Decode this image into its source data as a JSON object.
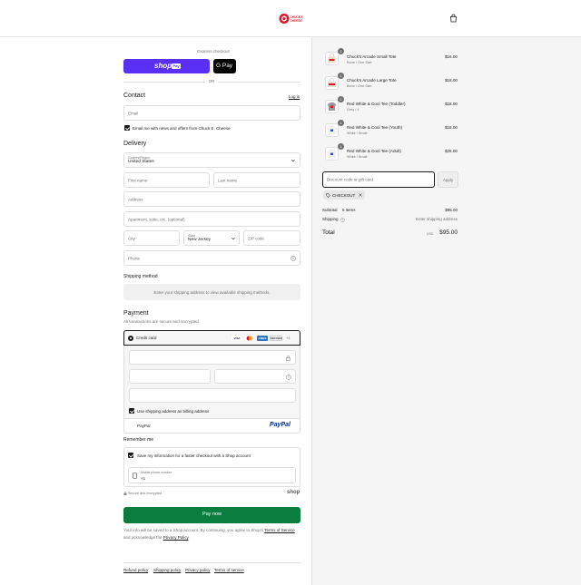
{
  "header": {
    "logo_text": "CHUCK E. CHEESE",
    "cart_icon": "shopping-bag-icon"
  },
  "express": {
    "title": "Express checkout",
    "shop_pay_label": "shop",
    "shop_pay_badge": "Pay",
    "gpay_label": "G Pay",
    "or_label": "OR"
  },
  "contact": {
    "heading": "Contact",
    "login_label": "Log in",
    "email_placeholder": "Email",
    "newsletter_label": "Email me with news and offers from Chuck E. Cheese"
  },
  "delivery": {
    "heading": "Delivery",
    "country_label": "Country/Region",
    "country_value": "United States",
    "first_name_placeholder": "First name",
    "last_name_placeholder": "Last name",
    "address_placeholder": "Address",
    "apartment_placeholder": "Apartment, suite, etc. (optional)",
    "city_placeholder": "City",
    "state_label": "State",
    "state_value": "New Jersey",
    "zip_placeholder": "ZIP code",
    "phone_placeholder": "Phone"
  },
  "shipping": {
    "heading": "Shipping method",
    "message": "Enter your shipping address to view available shipping methods."
  },
  "payment": {
    "heading": "Payment",
    "subtitle": "All transactions are secure and encrypted.",
    "credit_card_label": "Credit card",
    "card_brands": [
      "VISA",
      "MC",
      "AMEX",
      "DISCOVER"
    ],
    "more_cards": "+4",
    "billing_same_label": "Use shipping address as billing address",
    "paypal_label": "PayPal",
    "paypal_logo": "PayPal"
  },
  "remember": {
    "heading": "Remember me",
    "save_info_label": "Save my information for a faster checkout with a Shop account",
    "phone_label": "Mobile phone number",
    "phone_value": "+1",
    "secure_label": "Secure and encrypted",
    "shop_logo": "shop"
  },
  "pay_button_label": "Pay now",
  "disclaimer": {
    "text_1": "Your info will be saved to a Shop account. By continuing, you agree to Shop's ",
    "terms_label": "Terms of Service",
    "text_2": "and acknowledge the ",
    "privacy_label": "Privacy Policy",
    "text_3": "."
  },
  "footer_links": [
    "Refund policy",
    "Shipping policy",
    "Privacy policy",
    "Terms of service"
  ],
  "order_items": [
    {
      "qty": "1",
      "name": "Chuck's Arcade Small Tote",
      "variant": "Bone / One Size",
      "price": "$16.00"
    },
    {
      "qty": "1",
      "name": "Chuck's Arcade Large Tote",
      "variant": "Bone / One Size",
      "price": "$18.00"
    },
    {
      "qty": "1",
      "name": "Red White & Cool Tee (Toddler)",
      "variant": "Grey / 4",
      "price": "$18.00"
    },
    {
      "qty": "1",
      "name": "Red White & Cool Tee (Youth)",
      "variant": "White / Small",
      "price": "$18.00"
    },
    {
      "qty": "1",
      "name": "Red White & Cool Tee (Adult)",
      "variant": "White / Small",
      "price": "$25.00"
    }
  ],
  "discount": {
    "placeholder": "Discount code or gift card",
    "apply_label": "Apply",
    "applied_code": "CHECKOUT"
  },
  "totals": {
    "subtotal_label": "Subtotal",
    "items_count": "5 items",
    "subtotal_value": "$95.00",
    "shipping_label": "Shipping",
    "shipping_value": "Enter shipping address",
    "total_label": "Total",
    "currency": "USD",
    "total_value": "$95.00"
  },
  "colors": {
    "shop_pay": "#5a31f4",
    "pay_button": "#0b7d3e",
    "paypal_blue": "#003087",
    "paypal_light": "#009cde",
    "brand_red": "#d7192b"
  }
}
